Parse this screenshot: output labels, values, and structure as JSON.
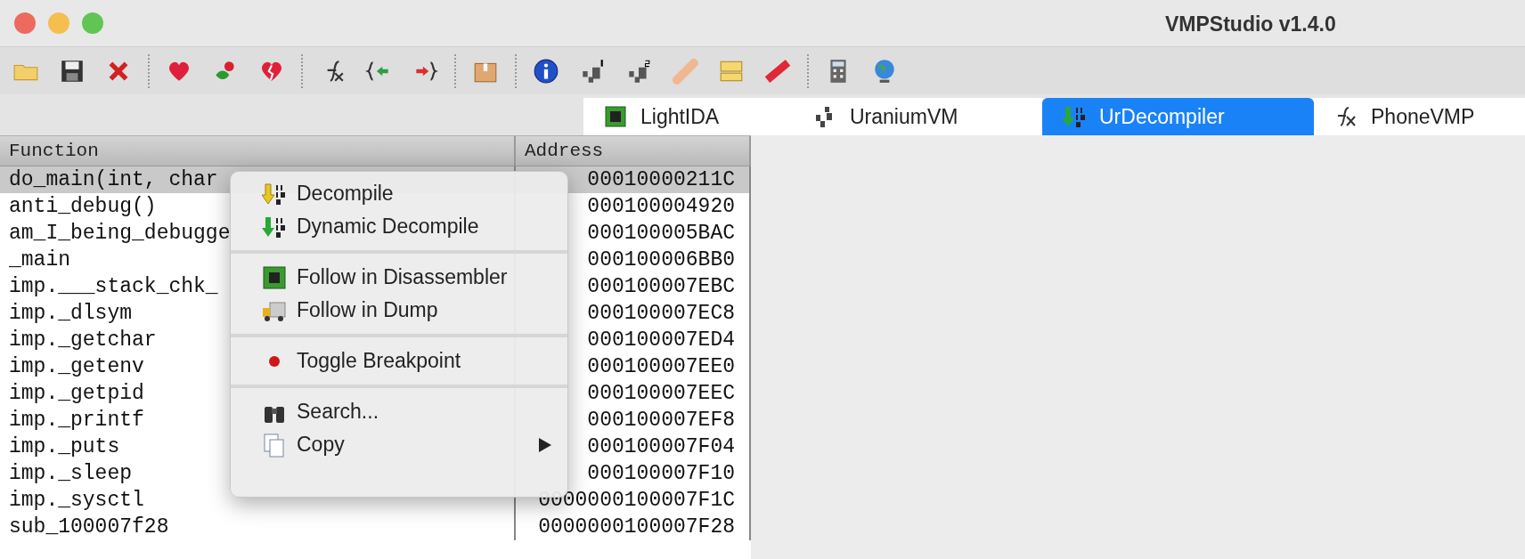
{
  "window": {
    "title": "VMPStudio v1.4.0"
  },
  "tabs": [
    {
      "label": "LightIDA",
      "selected": false
    },
    {
      "label": "UraniumVM",
      "selected": false
    },
    {
      "label": "UrDecompiler",
      "selected": true
    },
    {
      "label": "PhoneVMP",
      "selected": false
    }
  ],
  "table": {
    "columns": [
      "Function",
      "Address"
    ],
    "rows": [
      {
        "function": "do_main(int, char",
        "address": "00010000211C",
        "selected": true
      },
      {
        "function": "anti_debug()",
        "address": "000100004920",
        "selected": false
      },
      {
        "function": "am_I_being_debugge",
        "address": "000100005BAC",
        "selected": false
      },
      {
        "function": "_main",
        "address": "000100006BB0",
        "selected": false
      },
      {
        "function": "imp.___stack_chk_",
        "address": "000100007EBC",
        "selected": false
      },
      {
        "function": "imp._dlsym",
        "address": "000100007EC8",
        "selected": false
      },
      {
        "function": "imp._getchar",
        "address": "000100007ED4",
        "selected": false
      },
      {
        "function": "imp._getenv",
        "address": "000100007EE0",
        "selected": false
      },
      {
        "function": "imp._getpid",
        "address": "000100007EEC",
        "selected": false
      },
      {
        "function": "imp._printf",
        "address": "000100007EF8",
        "selected": false
      },
      {
        "function": "imp._puts",
        "address": "000100007F04",
        "selected": false
      },
      {
        "function": "imp._sleep",
        "address": "000100007F10",
        "selected": false
      },
      {
        "function": "imp._sysctl",
        "address": "0000000100007F1C",
        "selected": false
      },
      {
        "function": "sub_100007f28",
        "address": "0000000100007F28",
        "selected": false
      }
    ]
  },
  "context_menu": {
    "sections": [
      [
        {
          "label": "Decompile",
          "submenu": false
        },
        {
          "label": "Dynamic Decompile",
          "submenu": false
        }
      ],
      [
        {
          "label": "Follow in Disassembler",
          "submenu": false
        },
        {
          "label": "Follow in Dump",
          "submenu": false
        }
      ],
      [
        {
          "label": "Toggle Breakpoint",
          "submenu": false
        }
      ],
      [
        {
          "label": "Search...",
          "submenu": false
        },
        {
          "label": "Copy",
          "submenu": true
        }
      ]
    ]
  }
}
